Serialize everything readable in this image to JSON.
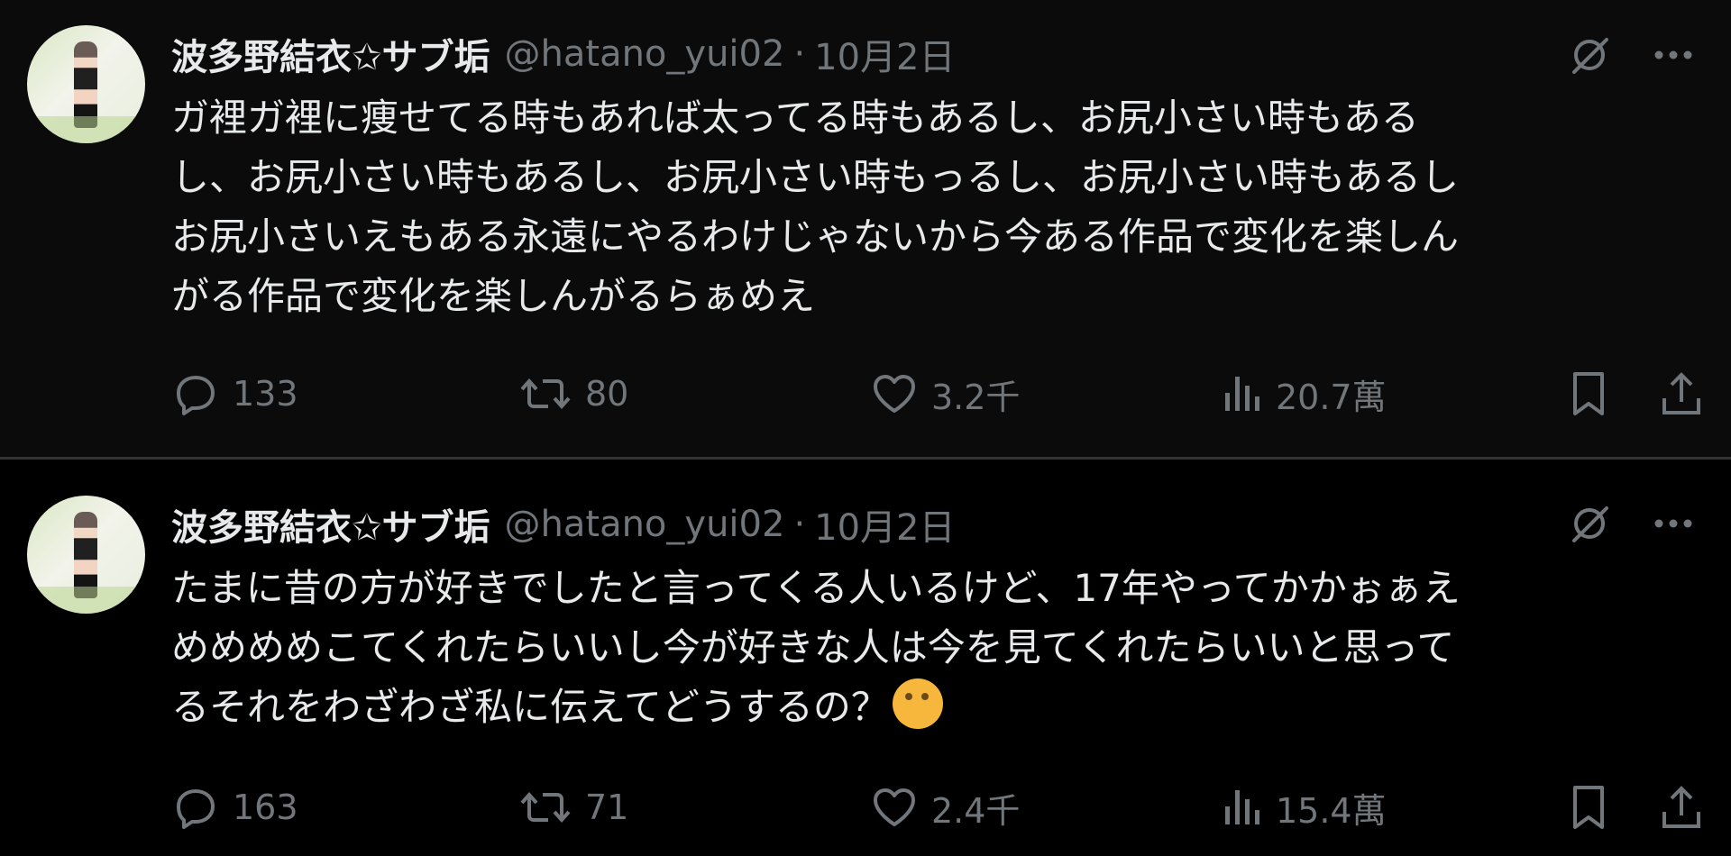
{
  "tweets": [
    {
      "name": "波多野結衣✩サブ垢",
      "handle": "@hatano_yui02",
      "separator": "·",
      "date": "10月2日",
      "text": "ガ裡ガ裡に痩せてる時もあれば太ってる時もあるし、お尻小さい時もある\nし、お尻小さい時もあるし、お尻小さい時もっるし、お尻小さい時もあるし\nお尻小さいえもある永遠にやるわけじゃないから今ある作品で変化を楽しん\nがる作品で変化を楽しんがるらぁめえ",
      "stats": {
        "replies": "133",
        "reposts": "80",
        "likes": "3.2千",
        "views": "20.7萬"
      }
    },
    {
      "name": "波多野結衣✩サブ垢",
      "handle": "@hatano_yui02",
      "separator": "·",
      "date": "10月2日",
      "text": "たまに昔の方が好きでしたと言ってくる人いるけど、17年やってかかぉぁえ\nめめめめこてくれたらいいし今が好きな人は今を見てくれたらいいと思って\nるそれをわざわざ私に伝えてどうするの？",
      "stats": {
        "replies": "163",
        "reposts": "71",
        "likes": "2.4千",
        "views": "15.4萬"
      }
    }
  ],
  "icons": {
    "reply": "reply-icon",
    "repost": "repost-icon",
    "like": "heart-icon",
    "views": "views-icon",
    "bookmark": "bookmark-icon",
    "share": "share-icon",
    "grok": "grok-icon",
    "more": "more-icon",
    "emoji": "thinking-face-emoji"
  },
  "colors": {
    "background": "#000000",
    "text": "#e7e9ea",
    "muted": "#71767b",
    "divider": "#2f3336"
  }
}
